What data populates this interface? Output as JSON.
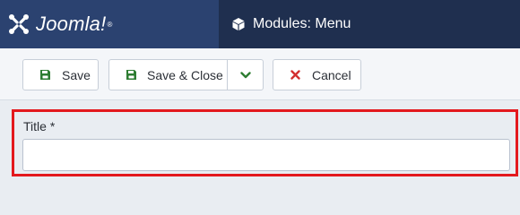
{
  "header": {
    "brand": {
      "name": "Joomla!",
      "registered_mark": "®",
      "logo_icon": "joomla-logo-icon"
    },
    "page": {
      "icon": "cube-icon",
      "title": "Modules: Menu"
    }
  },
  "toolbar": {
    "save_label": "Save",
    "save_close_label": "Save & Close",
    "cancel_label": "Cancel",
    "icons": {
      "save": "floppy-disk-icon",
      "dropdown": "chevron-down-icon",
      "cancel": "close-icon"
    },
    "colors": {
      "save_icon": "#2e7d32",
      "cancel_icon": "#d32f2f"
    }
  },
  "form": {
    "title_label": "Title *",
    "title_value": "",
    "highlight_color": "#e3191e"
  }
}
